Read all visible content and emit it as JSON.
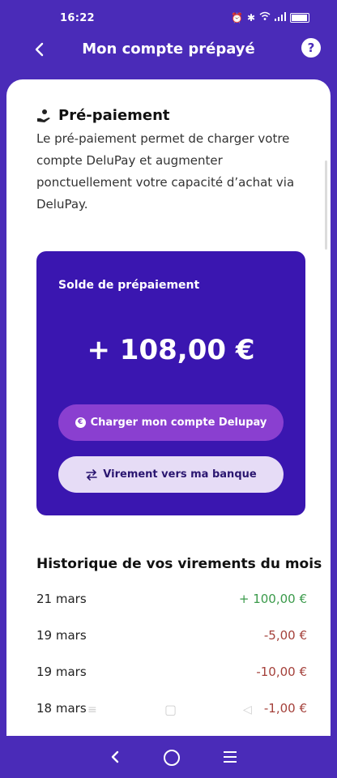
{
  "status_bar": {
    "time": "16:22"
  },
  "header": {
    "title": "Mon compte prépayé",
    "help_label": "?"
  },
  "prepayment": {
    "title": "Pré-paiement",
    "description": "Le pré-paiement permet de charger votre compte DeluPay et augmenter ponctuellement votre capacité d’achat via DeluPay."
  },
  "balance": {
    "label": "Solde de prépaiement",
    "amount": "+ 108,00 €",
    "charge_button": "Charger mon compte Delupay",
    "transfer_button": "Virement vers ma banque"
  },
  "history": {
    "title": "Historique de vos virements du mois",
    "rows": [
      {
        "date": "21 mars",
        "amount": "+ 100,00 €"
      },
      {
        "date": "19 mars",
        "amount": "-5,00 €"
      },
      {
        "date": "19 mars",
        "amount": "-10,00 €"
      },
      {
        "date": "18 mars",
        "amount": "-1,00 €"
      }
    ]
  },
  "colors": {
    "brand": "#4a2bb8",
    "card": "#3a16b0",
    "charge_button": "#8a3fd0",
    "transfer_button": "#e6dcf6",
    "positive": "#3a9a4a",
    "negative": "#a4403a"
  },
  "icons": {
    "prepayment": "hand-coin-icon",
    "charge": "coin-icon",
    "transfer": "transfer-arrows-icon"
  }
}
